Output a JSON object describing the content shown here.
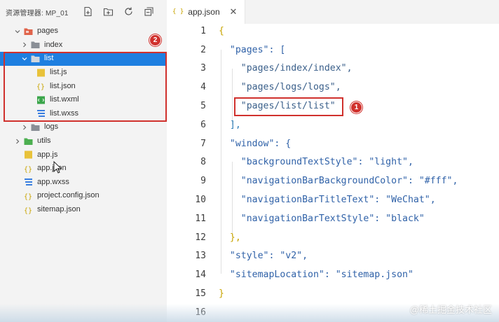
{
  "explorer": {
    "title": "资源管理器: MP_01",
    "actions": [
      "new-file-icon",
      "new-folder-icon",
      "refresh-icon",
      "collapse-all-icon"
    ],
    "items": [
      {
        "label": "pages",
        "type": "folder-open",
        "level": 0
      },
      {
        "label": "index",
        "type": "folder-closed",
        "level": 1
      },
      {
        "label": "list",
        "type": "folder-open",
        "level": 1,
        "selected": true
      },
      {
        "label": "list.js",
        "type": "js",
        "level": 2
      },
      {
        "label": "list.json",
        "type": "json",
        "level": 2
      },
      {
        "label": "list.wxml",
        "type": "wxml",
        "level": 2
      },
      {
        "label": "list.wxss",
        "type": "wxss",
        "level": 2
      },
      {
        "label": "logs",
        "type": "folder-closed",
        "level": 1
      },
      {
        "label": "utils",
        "type": "folder-closed",
        "level": 0
      },
      {
        "label": "app.js",
        "type": "js",
        "level": 0
      },
      {
        "label": "app.json",
        "type": "json",
        "level": 0
      },
      {
        "label": "app.wxss",
        "type": "wxss",
        "level": 0
      },
      {
        "label": "project.config.json",
        "type": "json",
        "level": 0
      },
      {
        "label": "sitemap.json",
        "type": "json",
        "level": 0
      }
    ]
  },
  "editor": {
    "tab": {
      "icon": "{ }",
      "label": "app.json"
    },
    "lines": [
      {
        "n": "1",
        "text": "{"
      },
      {
        "n": "2",
        "text": "  \"pages\": ["
      },
      {
        "n": "3",
        "text": "    \"pages/index/index\","
      },
      {
        "n": "4",
        "text": "    \"pages/logs/logs\","
      },
      {
        "n": "5",
        "text": "    \"pages/list/list\""
      },
      {
        "n": "6",
        "text": "  ],"
      },
      {
        "n": "7",
        "text": "  \"window\": {"
      },
      {
        "n": "8",
        "text": "    \"backgroundTextStyle\": \"light\","
      },
      {
        "n": "9",
        "text": "    \"navigationBarBackgroundColor\": \"#fff\","
      },
      {
        "n": "10",
        "text": "    \"navigationBarTitleText\": \"WeChat\","
      },
      {
        "n": "11",
        "text": "    \"navigationBarTextStyle\": \"black\""
      },
      {
        "n": "12",
        "text": "  },"
      },
      {
        "n": "13",
        "text": "  \"style\": \"v2\","
      },
      {
        "n": "14",
        "text": "  \"sitemapLocation\": \"sitemap.json\""
      },
      {
        "n": "15",
        "text": "}"
      },
      {
        "n": "16",
        "text": ""
      }
    ]
  },
  "annotations": {
    "badge1": "1",
    "badge2": "2"
  },
  "watermark": "@稀土掘金技术社区",
  "colors": {
    "selection": "#1e7fe0",
    "callout": "#d0312d",
    "folder": "#8a8f96",
    "pages_folder": "#e0634a",
    "js": "#e8c23a",
    "json": "#c8a400",
    "wxml": "#3aa54a",
    "wxss": "#3a7ee0"
  }
}
